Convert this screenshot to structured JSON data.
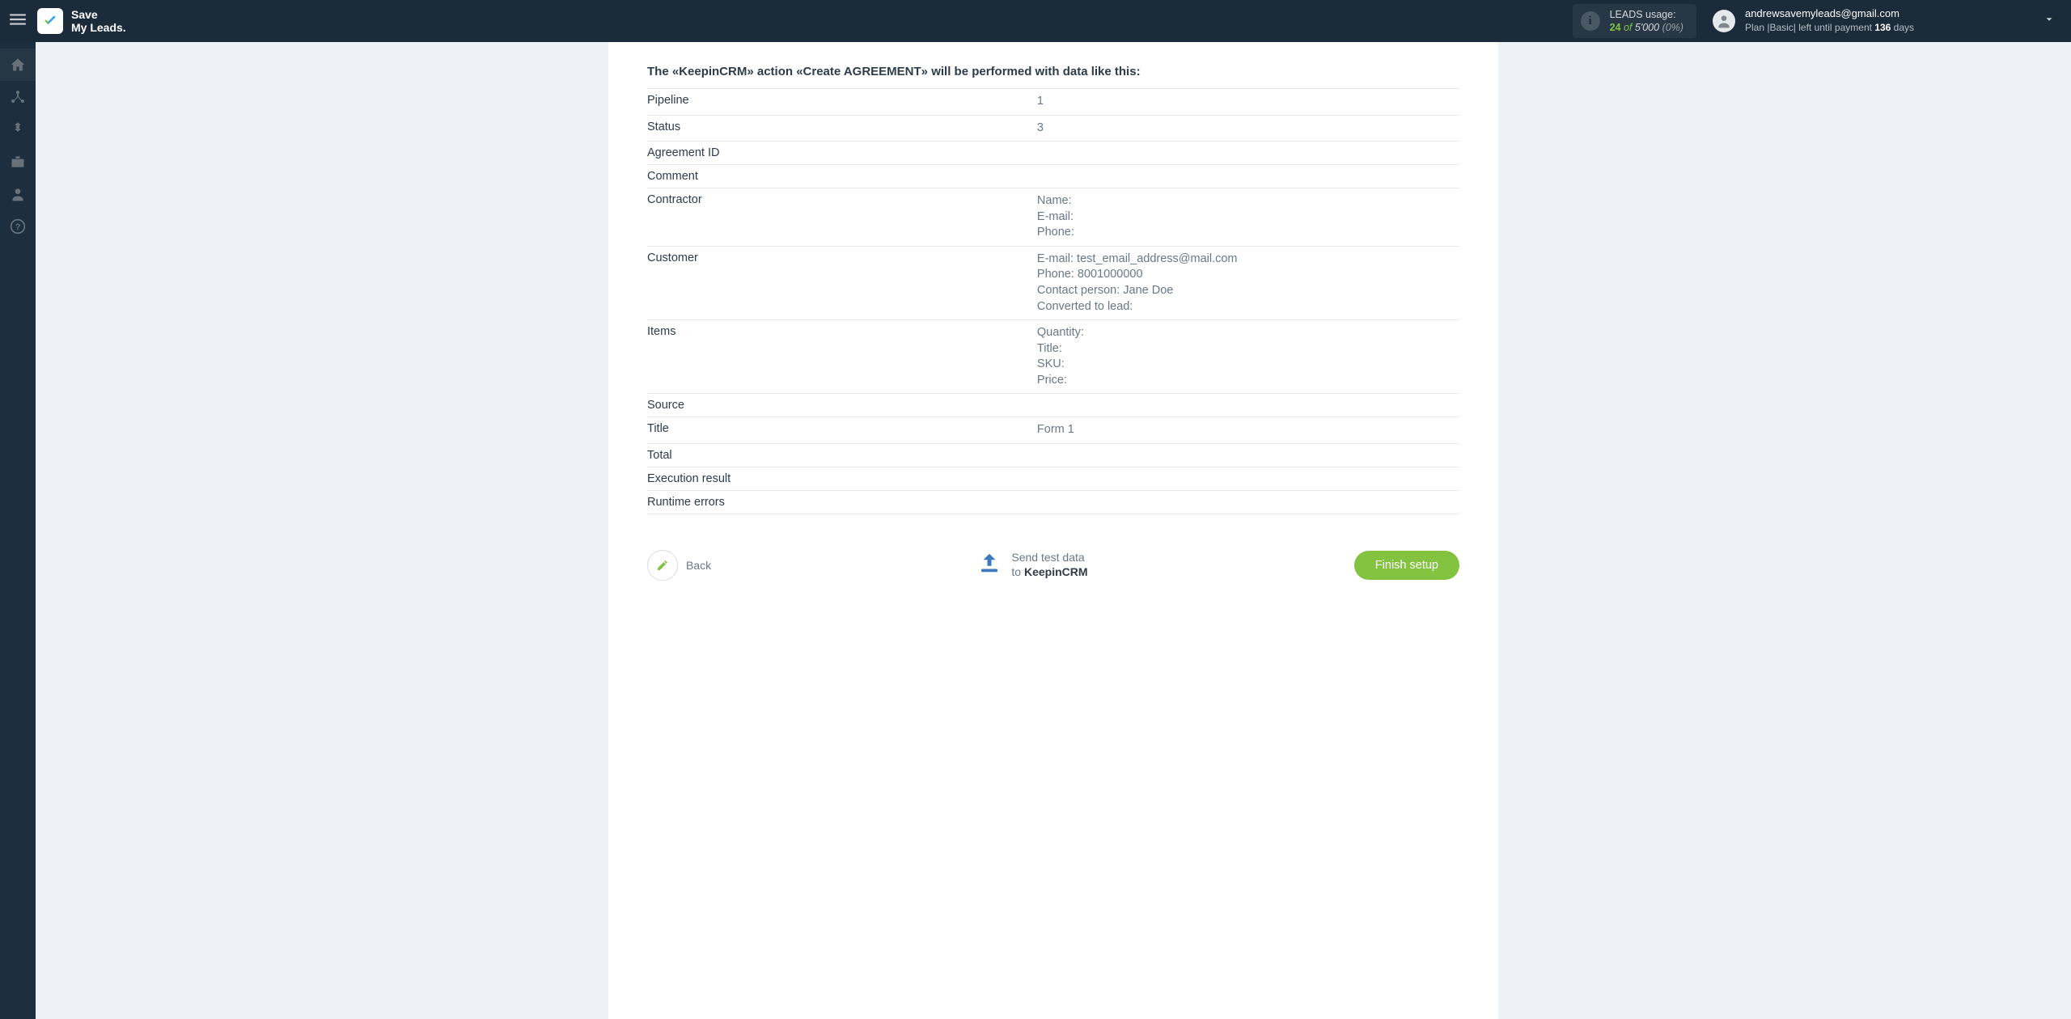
{
  "header": {
    "logo_line1": "Save",
    "logo_line2": "My Leads.",
    "usage_title": "LEADS usage:",
    "usage_count": "24",
    "usage_of": "of",
    "usage_total": "5'000",
    "usage_pct": "(0%)",
    "email": "andrewsavemyleads@gmail.com",
    "plan_prefix": "Plan |",
    "plan_name": "Basic",
    "plan_left": "| left until payment ",
    "plan_days": "136",
    "plan_days_word": " days"
  },
  "panel": {
    "title": "The «KeepinCRM» action «Create AGREEMENT» will be performed with data like this:",
    "rows": [
      {
        "label": "Pipeline",
        "value": "1"
      },
      {
        "label": "Status",
        "value": "3"
      },
      {
        "label": "Agreement ID",
        "value": ""
      },
      {
        "label": "Comment",
        "value": ""
      },
      {
        "label": "Contractor",
        "value": "Name:\nE-mail:\nPhone:"
      },
      {
        "label": "Customer",
        "value": "E-mail: test_email_address@mail.com\nPhone: 8001000000\nContact person: Jane Doe\nConverted to lead:"
      },
      {
        "label": "Items",
        "value": "Quantity:\nTitle:\nSKU:\nPrice:"
      },
      {
        "label": "Source",
        "value": ""
      },
      {
        "label": "Title",
        "value": "Form 1"
      },
      {
        "label": "Total",
        "value": ""
      },
      {
        "label": "Execution result",
        "value": ""
      },
      {
        "label": "Runtime errors",
        "value": ""
      }
    ]
  },
  "footer": {
    "back": "Back",
    "send_line1": "Send test data",
    "send_line2_prefix": "to ",
    "send_dest": "KeepinCRM",
    "finish": "Finish setup"
  }
}
